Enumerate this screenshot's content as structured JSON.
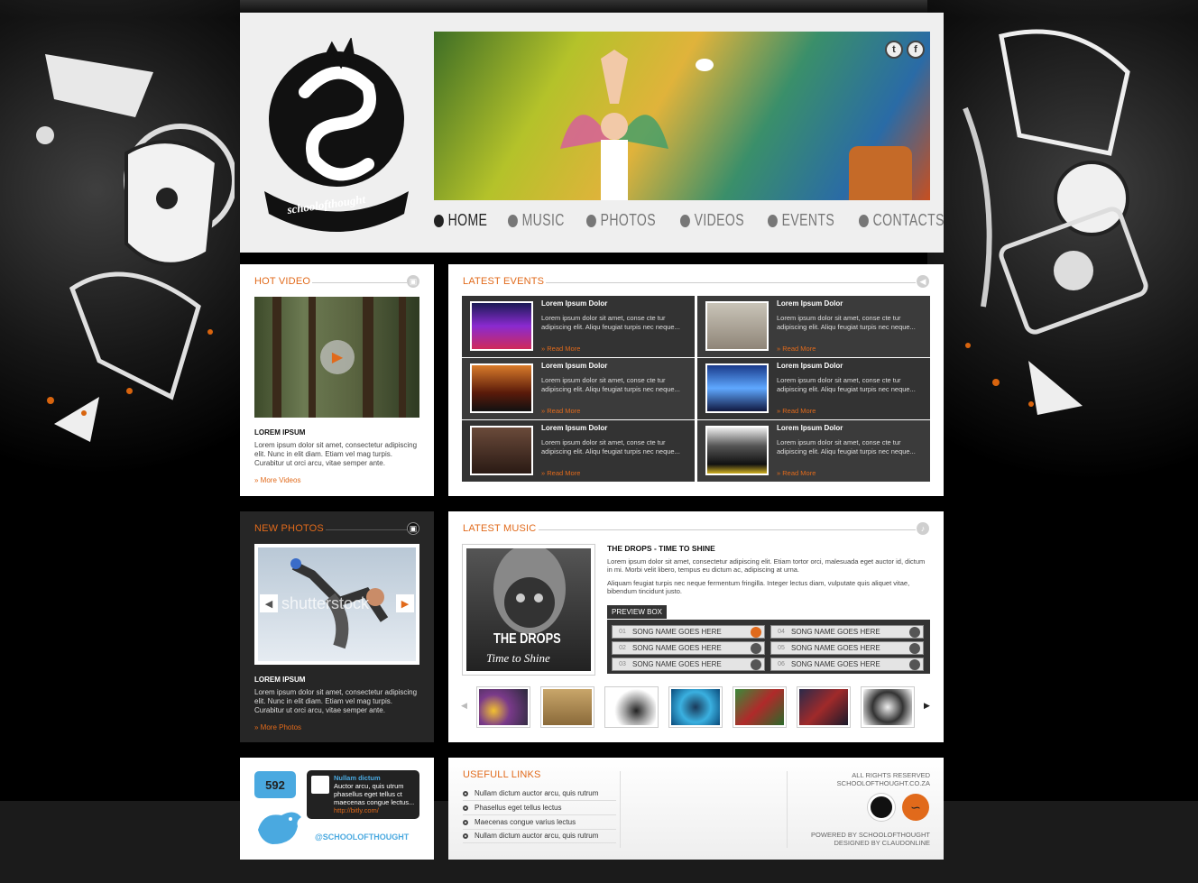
{
  "header": {
    "logo_text": "schoolofthought",
    "social": [
      "t",
      "f"
    ]
  },
  "nav": [
    {
      "label": "HOME",
      "active": true
    },
    {
      "label": "MUSIC",
      "active": false
    },
    {
      "label": "PHOTOS",
      "active": false
    },
    {
      "label": "VIDEOS",
      "active": false
    },
    {
      "label": "EVENTS",
      "active": false
    },
    {
      "label": "CONTACTS",
      "active": false
    }
  ],
  "hot_video": {
    "title": "HOT VIDEO",
    "heading": "LOREM IPSUM",
    "text": "Lorem ipsum dolor sit amet, consectetur adipiscing elit. Nunc in elit diam. Etiam vel mag turpis. Curabitur ut orci arcu, vitae semper ante.",
    "more": "More Videos"
  },
  "latest_events": {
    "title": "LATEST EVENTS",
    "items": [
      {
        "title": "Lorem Ipsum Dolor",
        "text": "Lorem ipsum dolor sit amet, conse cte tur adipiscing elit. Aliqu feugiat turpis nec neque...",
        "more": "Read More"
      },
      {
        "title": "Lorem Ipsum Dolor",
        "text": "Lorem ipsum dolor sit amet, conse cte tur adipiscing elit. Aliqu feugiat turpis nec neque...",
        "more": "Read More"
      },
      {
        "title": "Lorem Ipsum Dolor",
        "text": "Lorem ipsum dolor sit amet, conse cte tur adipiscing elit. Aliqu feugiat turpis nec neque...",
        "more": "Read More"
      },
      {
        "title": "Lorem Ipsum Dolor",
        "text": "Lorem ipsum dolor sit amet, conse cte tur adipiscing elit. Aliqu feugiat turpis nec neque...",
        "more": "Read More"
      },
      {
        "title": "Lorem Ipsum Dolor",
        "text": "Lorem ipsum dolor sit amet, conse cte tur adipiscing elit. Aliqu feugiat turpis nec neque...",
        "more": "Read More"
      },
      {
        "title": "Lorem Ipsum Dolor",
        "text": "Lorem ipsum dolor sit amet, conse cte tur adipiscing elit. Aliqu feugiat turpis nec neque...",
        "more": "Read More"
      }
    ]
  },
  "new_photos": {
    "title": "NEW PHOTOS",
    "watermark": "shutterstock",
    "heading": "LOREM IPSUM",
    "text": "Lorem ipsum dolor sit amet, consectetur adipiscing elit. Nunc in elit diam. Etiam vel mag turpis. Curabitur ut orci arcu, vitae semper ante.",
    "more": "More Photos"
  },
  "latest_music": {
    "title": "LATEST MUSIC",
    "album_line1": "THE DROPS",
    "album_line2": "Time to Shine",
    "track_title": "THE DROPS - TIME TO SHINE",
    "para1": "Lorem ipsum dolor sit amet, consectetur adipiscing elit. Etiam tortor orci, malesuada eget auctor id, dictum in mi. Morbi velit libero, tempus eu dictum ac, adipiscing at urna.",
    "para2": "Aliquam feugiat turpis nec neque fermentum fringilla. Integer lectus diam, vulputate quis aliquet vitae, bibendum tincidunt justo.",
    "preview_label": "PREVIEW BOX",
    "songs": [
      {
        "num": "01",
        "name": "SONG NAME GOES HERE"
      },
      {
        "num": "02",
        "name": "SONG NAME GOES HERE"
      },
      {
        "num": "03",
        "name": "SONG NAME GOES HERE"
      },
      {
        "num": "04",
        "name": "SONG NAME GOES HERE"
      },
      {
        "num": "05",
        "name": "SONG NAME GOES HERE"
      },
      {
        "num": "06",
        "name": "SONG NAME GOES HERE"
      }
    ]
  },
  "twitter": {
    "count": "592",
    "tweet_user": "Nullam dictum",
    "tweet_text": "Auctor arcu, quis utrum phasellus eget tellus ct maecenas congue lectus...",
    "tweet_link": "http://bitly.com/",
    "handle": "@SCHOOLOFTHOUGHT"
  },
  "useful_links": {
    "title": "USEFULL LINKS",
    "items": [
      "Nullam dictum auctor arcu, quis rutrum",
      "Phasellus eget tellus lectus",
      "Maecenas congue varius lectus",
      "Nullam dictum auctor arcu, quis rutrum"
    ]
  },
  "footer": {
    "rights": "ALL RIGHTS RESERVED",
    "site": "SCHOOLOFTHOUGHT.CO.ZA",
    "powered": "POWERED BY SCHOOLOFTHOUGHT",
    "designed": "DESIGNED BY CLAUDONLINE"
  },
  "colors": {
    "accent": "#e16a1b",
    "dark": "#262626",
    "twitter": "#4aa9e0"
  }
}
